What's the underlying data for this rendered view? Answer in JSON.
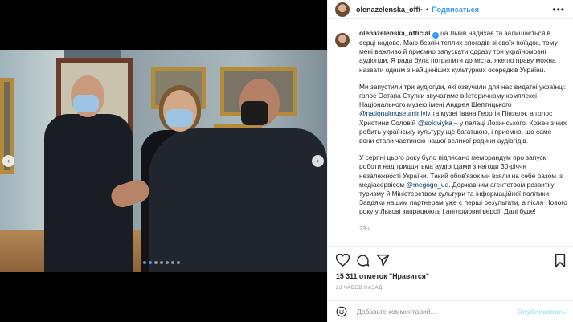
{
  "post": {
    "username": "olenazelenska_offi·",
    "follow_label": "Подписаться",
    "dot": "•",
    "more_label": "•••",
    "carousel": {
      "active_index": 1,
      "total": 7
    }
  },
  "caption": {
    "username": "olenazelenska_official",
    "verified_glyph": "✓",
    "paragraphs": {
      "p1_text": "ua Львів надихає та залишається в серці надово. Маю безліч теплих спогадів зі своїх поїздок, тому мені важливо й приємно запускати одразу три україномовні аудіогіди. Я рада була потрапити до міста, яке по праву можна назвати одним з найцінніших культурних осередків України.",
      "p2_a": "Ми запустили три аудіогіди, які озвучили для нас видатні українці: голос Остапа Ступки звучатиме в Історичному комплексі Національного музею імені Андрея Шептицького ",
      "p2_mention1": "@nationalmuseuminlviv",
      "p2_b": " та музеї Івана Георгія Пінзеля, а голос Христини Соловій ",
      "p2_mention2": "@soloviyka",
      "p2_c": " – у палаці Лозинського. Кожен з них робить українську культуру ще багатшою, і приємно, що саме вони стали частиною нашої великої родини аудіогідів.",
      "p3_a": "У серпні цього року було підписано меморандум про запуск роботи над тридцятьма аудіогідами з нагоди 30-річчя незалежності України. Такий обов'язок ми взяли на себе разом із медіасервісом ",
      "p3_mention": "@megogo_ua",
      "p3_b": ". Державним агентством розвитку туризму й Міністерством культури та інформаційної політики. Завдяки нашим партнерам уже є перші результати, а після Нового року у Львові запрацюють і англомовні версії. Далі буде!"
    },
    "time": "23 ч."
  },
  "engagement": {
    "likes_text": "15 311 отметок \"Нравится\"",
    "ago_text": "23 ЧАСОВ НАЗАД"
  },
  "comment_box": {
    "placeholder": "Добавьте комментарий...",
    "post_label": "Опубликовать"
  },
  "icons": {
    "carousel_left": "‹",
    "carousel_right": "›"
  },
  "colors": {
    "accent": "#3897f0",
    "post_disabled": "#b2dffc",
    "muted": "#8e8e8e"
  }
}
